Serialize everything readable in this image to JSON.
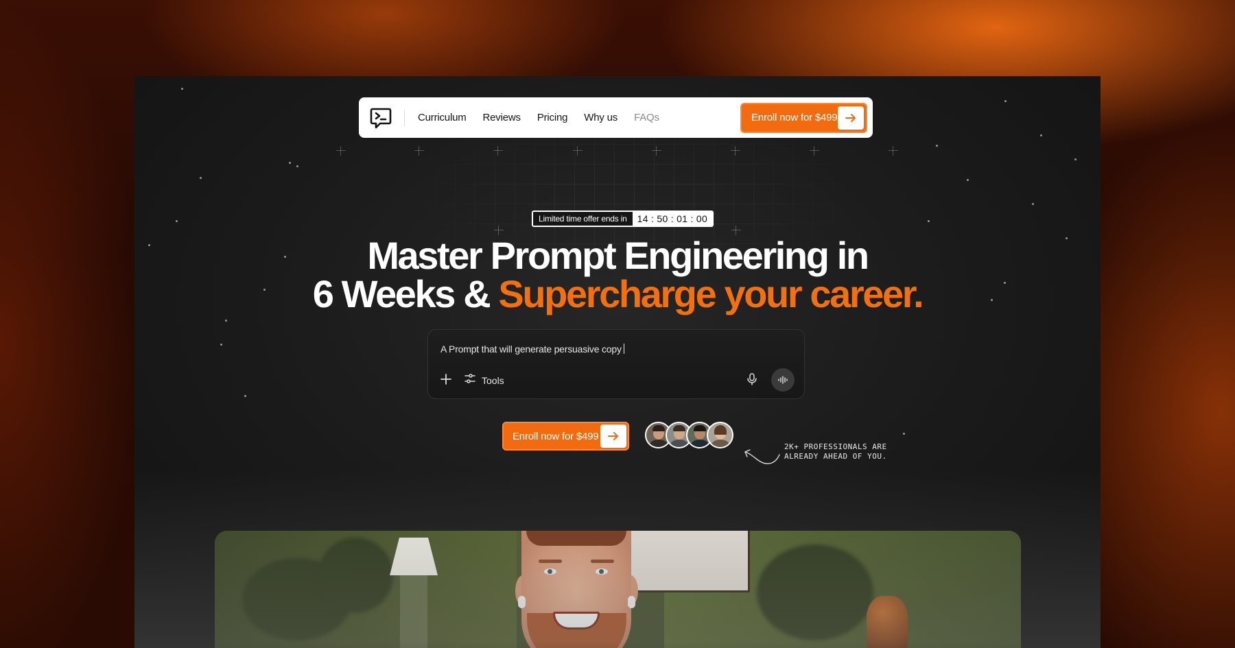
{
  "nav": {
    "logo": "prompt-chat-icon",
    "links": [
      {
        "label": "Curriculum"
      },
      {
        "label": "Reviews"
      },
      {
        "label": "Pricing"
      },
      {
        "label": "Why us"
      },
      {
        "label": "FAQs"
      }
    ],
    "cta_label": "Enroll now for $499"
  },
  "offer": {
    "label": "Limited time offer ends in",
    "timer": "14 : 50 : 01 : 00"
  },
  "hero": {
    "line1": "Master Prompt Engineering in",
    "line2_white": "6 Weeks & ",
    "line2_accent": "Supercharge your career."
  },
  "prompt": {
    "value": "A Prompt that will generate persuasive copy",
    "tools_label": "Tools"
  },
  "cta": {
    "label": "Enroll now for $499"
  },
  "social_proof": {
    "note_line1": "2k+ Professionals are",
    "note_line2": "already ahead of you."
  },
  "colors": {
    "accent": "#f26b0f",
    "background_dark": "#1b1b1b",
    "nav_bg": "#ffffff"
  }
}
